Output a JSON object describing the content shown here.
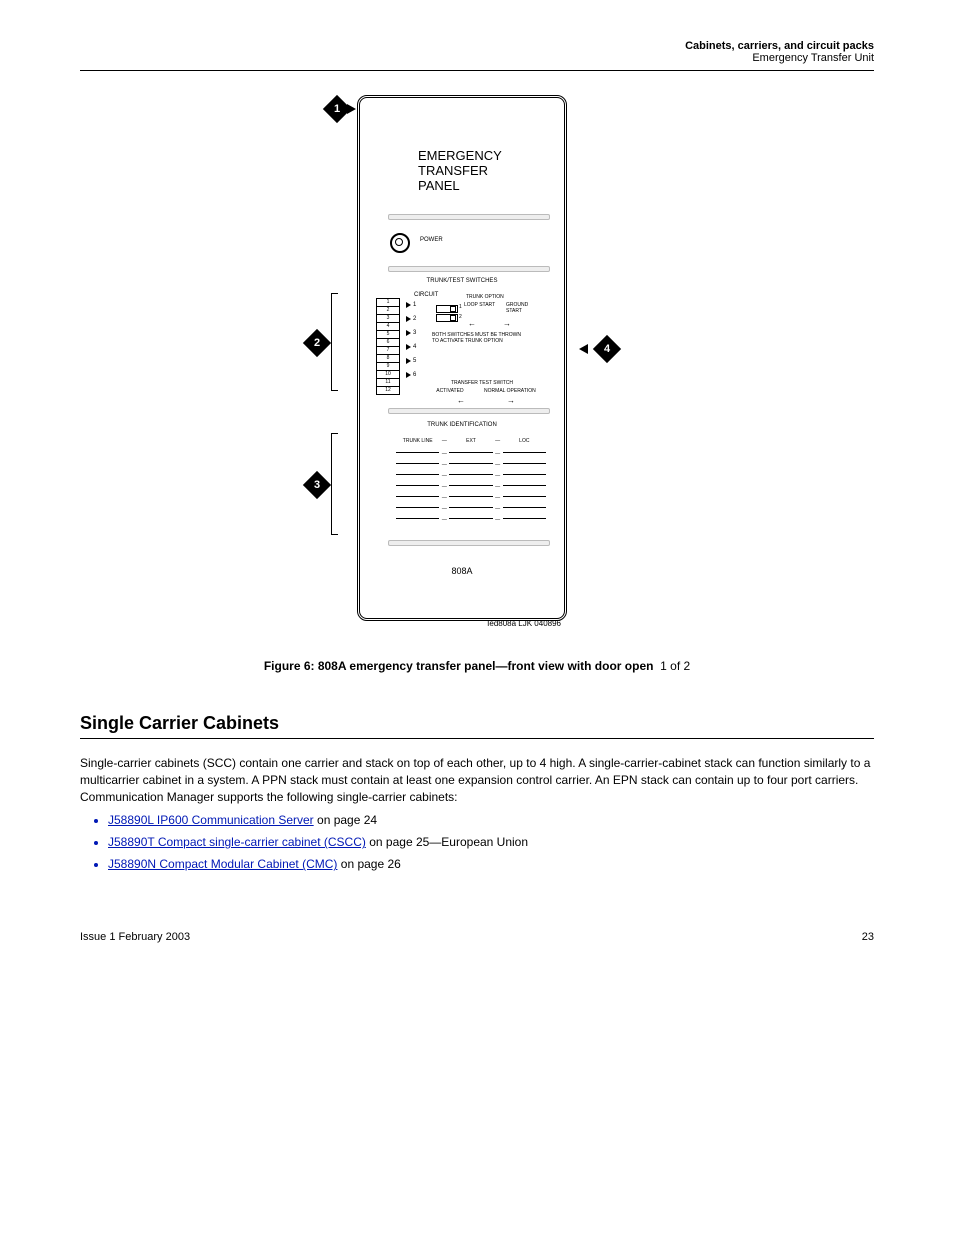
{
  "header": {
    "section": "Cabinets, carriers, and circuit packs",
    "subsection": "Emergency Transfer Unit"
  },
  "panel": {
    "title1": "EMERGENCY",
    "title2": "TRANSFER",
    "title3": "PANEL",
    "power": "POWER",
    "trunk_switches": "TRUNK/TEST SWITCHES",
    "circuit": "CIRCUIT",
    "terminals": [
      "1",
      "2",
      "3",
      "4",
      "5",
      "6",
      "7",
      "8",
      "9",
      "10",
      "11",
      "12"
    ],
    "circuit_nos": [
      "1",
      "2",
      "3",
      "4",
      "5",
      "6"
    ],
    "trunk_option": "TRUNK OPTION",
    "loop_start": "LOOP START",
    "ground_start": "GROUND START",
    "dip_nums": [
      "1",
      "2"
    ],
    "both_switches": "BOTH SWITCHES MUST BE THROWN TO ACTIVATE TRUNK OPTION",
    "transfer_test": "TRANSFER TEST SWITCH",
    "activated": "ACTIVATED",
    "normal_op": "NORMAL OPERATION",
    "tid": "TRUNK IDENTIFICATION",
    "tid_cols": {
      "trunk_line": "TRUNK LINE",
      "ext": "EXT",
      "loc": "LOC"
    },
    "model": "808A",
    "image_id": "Ied808a LJK 040896"
  },
  "callouts": {
    "c1": "1",
    "c2": "2",
    "c3": "3",
    "c4": "4"
  },
  "caption": {
    "bold": "Figure 6: 808A emergency transfer panel—front view with door open",
    "page": "1 of 2"
  },
  "scc": {
    "title": "Single Carrier Cabinets",
    "para1": "Single-carrier cabinets (SCC) contain one carrier and stack on top of each other, up to 4 high. A single-carrier-cabinet stack can function similarly to a multicarrier cabinet in a system. A PPN stack must contain at least one expansion control carrier. An EPN stack can contain up to four port carriers. Communication Manager supports the following single-carrier cabinets:",
    "links": [
      {
        "text": "J58890L IP600 Communication Server",
        "page": "on page 24"
      },
      {
        "text": "J58890T Compact single-carrier cabinet (CSCC)",
        "page": "on page 25"
      },
      {
        "text": "J58890N Compact Modular Cabinet (CMC)",
        "page": "on page 26"
      }
    ],
    "note_extra": "—European Union",
    "footer_left": "Issue 1 February 2003",
    "footer_right": "23"
  }
}
